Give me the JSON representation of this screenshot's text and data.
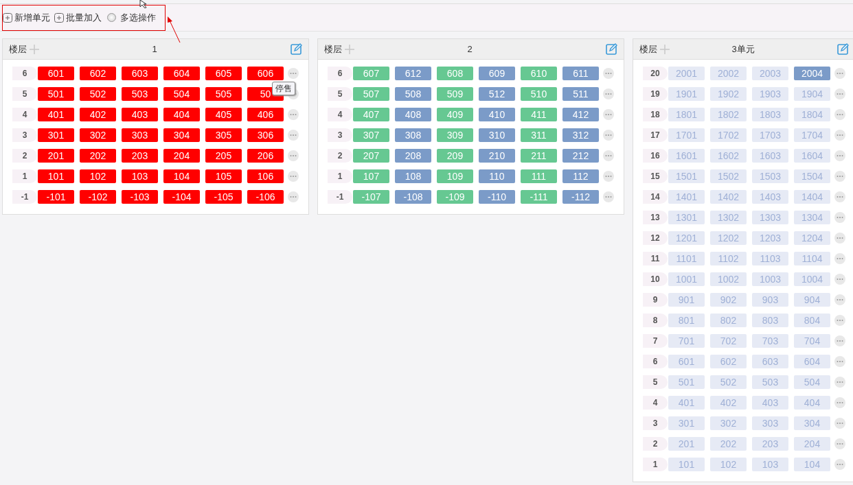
{
  "toolbar": {
    "buttons": [
      {
        "label": "新增单元"
      },
      {
        "label": "批量加入"
      }
    ],
    "multi_select": {
      "label": "多选操作",
      "checked": false
    }
  },
  "panels": [
    {
      "floor_label": "楼层",
      "title": "1",
      "floors": [
        {
          "floor": "6",
          "units": [
            {
              "number": "601",
              "kind": "stopped"
            },
            {
              "number": "602",
              "kind": "stopped"
            },
            {
              "number": "603",
              "kind": "stopped"
            },
            {
              "number": "604",
              "kind": "stopped"
            },
            {
              "number": "605",
              "kind": "stopped"
            },
            {
              "number": "606",
              "kind": "stopped"
            }
          ]
        },
        {
          "floor": "5",
          "units": [
            {
              "number": "501",
              "kind": "stopped"
            },
            {
              "number": "502",
              "kind": "stopped"
            },
            {
              "number": "503",
              "kind": "stopped"
            },
            {
              "number": "504",
              "kind": "stopped"
            },
            {
              "number": "505",
              "kind": "stopped"
            },
            {
              "number": "50",
              "kind": "stopped",
              "tooltip": "停售"
            }
          ]
        },
        {
          "floor": "4",
          "units": [
            {
              "number": "401",
              "kind": "stopped"
            },
            {
              "number": "402",
              "kind": "stopped"
            },
            {
              "number": "403",
              "kind": "stopped"
            },
            {
              "number": "404",
              "kind": "stopped"
            },
            {
              "number": "405",
              "kind": "stopped"
            },
            {
              "number": "406",
              "kind": "stopped"
            }
          ]
        },
        {
          "floor": "3",
          "units": [
            {
              "number": "301",
              "kind": "stopped"
            },
            {
              "number": "302",
              "kind": "stopped"
            },
            {
              "number": "303",
              "kind": "stopped"
            },
            {
              "number": "304",
              "kind": "stopped"
            },
            {
              "number": "305",
              "kind": "stopped"
            },
            {
              "number": "306",
              "kind": "stopped"
            }
          ]
        },
        {
          "floor": "2",
          "units": [
            {
              "number": "201",
              "kind": "stopped"
            },
            {
              "number": "202",
              "kind": "stopped"
            },
            {
              "number": "203",
              "kind": "stopped"
            },
            {
              "number": "204",
              "kind": "stopped"
            },
            {
              "number": "205",
              "kind": "stopped"
            },
            {
              "number": "206",
              "kind": "stopped"
            }
          ]
        },
        {
          "floor": "1",
          "units": [
            {
              "number": "101",
              "kind": "stopped"
            },
            {
              "number": "102",
              "kind": "stopped"
            },
            {
              "number": "103",
              "kind": "stopped"
            },
            {
              "number": "104",
              "kind": "stopped"
            },
            {
              "number": "105",
              "kind": "stopped"
            },
            {
              "number": "106",
              "kind": "stopped"
            }
          ]
        },
        {
          "floor": "-1",
          "units": [
            {
              "number": "-101",
              "kind": "stopped"
            },
            {
              "number": "-102",
              "kind": "stopped"
            },
            {
              "number": "-103",
              "kind": "stopped"
            },
            {
              "number": "-104",
              "kind": "stopped"
            },
            {
              "number": "-105",
              "kind": "stopped"
            },
            {
              "number": "-106",
              "kind": "stopped"
            }
          ]
        }
      ]
    },
    {
      "floor_label": "楼层",
      "title": "2",
      "floors": [
        {
          "floor": "6",
          "units": [
            {
              "number": "607",
              "kind": "green"
            },
            {
              "number": "612",
              "kind": "blue"
            },
            {
              "number": "608",
              "kind": "green"
            },
            {
              "number": "609",
              "kind": "blue"
            },
            {
              "number": "610",
              "kind": "green"
            },
            {
              "number": "611",
              "kind": "blue"
            }
          ]
        },
        {
          "floor": "5",
          "units": [
            {
              "number": "507",
              "kind": "green"
            },
            {
              "number": "508",
              "kind": "blue"
            },
            {
              "number": "509",
              "kind": "green"
            },
            {
              "number": "512",
              "kind": "blue"
            },
            {
              "number": "510",
              "kind": "green"
            },
            {
              "number": "511",
              "kind": "blue"
            }
          ]
        },
        {
          "floor": "4",
          "units": [
            {
              "number": "407",
              "kind": "green"
            },
            {
              "number": "408",
              "kind": "blue"
            },
            {
              "number": "409",
              "kind": "green"
            },
            {
              "number": "410",
              "kind": "blue"
            },
            {
              "number": "411",
              "kind": "green"
            },
            {
              "number": "412",
              "kind": "blue"
            }
          ]
        },
        {
          "floor": "3",
          "units": [
            {
              "number": "307",
              "kind": "green"
            },
            {
              "number": "308",
              "kind": "blue"
            },
            {
              "number": "309",
              "kind": "green"
            },
            {
              "number": "310",
              "kind": "blue"
            },
            {
              "number": "311",
              "kind": "green"
            },
            {
              "number": "312",
              "kind": "blue"
            }
          ]
        },
        {
          "floor": "2",
          "units": [
            {
              "number": "207",
              "kind": "green"
            },
            {
              "number": "208",
              "kind": "blue"
            },
            {
              "number": "209",
              "kind": "green"
            },
            {
              "number": "210",
              "kind": "blue"
            },
            {
              "number": "211",
              "kind": "green"
            },
            {
              "number": "212",
              "kind": "blue"
            }
          ]
        },
        {
          "floor": "1",
          "units": [
            {
              "number": "107",
              "kind": "green"
            },
            {
              "number": "108",
              "kind": "blue"
            },
            {
              "number": "109",
              "kind": "green"
            },
            {
              "number": "110",
              "kind": "blue"
            },
            {
              "number": "111",
              "kind": "green"
            },
            {
              "number": "112",
              "kind": "blue"
            }
          ]
        },
        {
          "floor": "-1",
          "units": [
            {
              "number": "-107",
              "kind": "green"
            },
            {
              "number": "-108",
              "kind": "blue"
            },
            {
              "number": "-109",
              "kind": "green"
            },
            {
              "number": "-110",
              "kind": "blue"
            },
            {
              "number": "-111",
              "kind": "green"
            },
            {
              "number": "-112",
              "kind": "blue"
            }
          ]
        }
      ]
    },
    {
      "floor_label": "楼层",
      "title": "3单元",
      "floors": [
        {
          "floor": "20",
          "units": [
            {
              "number": "2001",
              "kind": "empty"
            },
            {
              "number": "2002",
              "kind": "empty"
            },
            {
              "number": "2003",
              "kind": "empty"
            },
            {
              "number": "2004",
              "kind": "blue"
            }
          ]
        },
        {
          "floor": "19",
          "units": [
            {
              "number": "1901",
              "kind": "empty"
            },
            {
              "number": "1902",
              "kind": "empty"
            },
            {
              "number": "1903",
              "kind": "empty"
            },
            {
              "number": "1904",
              "kind": "empty"
            }
          ]
        },
        {
          "floor": "18",
          "units": [
            {
              "number": "1801",
              "kind": "empty"
            },
            {
              "number": "1802",
              "kind": "empty"
            },
            {
              "number": "1803",
              "kind": "empty"
            },
            {
              "number": "1804",
              "kind": "empty"
            }
          ]
        },
        {
          "floor": "17",
          "units": [
            {
              "number": "1701",
              "kind": "empty"
            },
            {
              "number": "1702",
              "kind": "empty"
            },
            {
              "number": "1703",
              "kind": "empty"
            },
            {
              "number": "1704",
              "kind": "empty"
            }
          ]
        },
        {
          "floor": "16",
          "units": [
            {
              "number": "1601",
              "kind": "empty"
            },
            {
              "number": "1602",
              "kind": "empty"
            },
            {
              "number": "1603",
              "kind": "empty"
            },
            {
              "number": "1604",
              "kind": "empty"
            }
          ]
        },
        {
          "floor": "15",
          "units": [
            {
              "number": "1501",
              "kind": "empty"
            },
            {
              "number": "1502",
              "kind": "empty"
            },
            {
              "number": "1503",
              "kind": "empty"
            },
            {
              "number": "1504",
              "kind": "empty"
            }
          ]
        },
        {
          "floor": "14",
          "units": [
            {
              "number": "1401",
              "kind": "empty"
            },
            {
              "number": "1402",
              "kind": "empty"
            },
            {
              "number": "1403",
              "kind": "empty"
            },
            {
              "number": "1404",
              "kind": "empty"
            }
          ]
        },
        {
          "floor": "13",
          "units": [
            {
              "number": "1301",
              "kind": "empty"
            },
            {
              "number": "1302",
              "kind": "empty"
            },
            {
              "number": "1303",
              "kind": "empty"
            },
            {
              "number": "1304",
              "kind": "empty"
            }
          ]
        },
        {
          "floor": "12",
          "units": [
            {
              "number": "1201",
              "kind": "empty"
            },
            {
              "number": "1202",
              "kind": "empty"
            },
            {
              "number": "1203",
              "kind": "empty"
            },
            {
              "number": "1204",
              "kind": "empty"
            }
          ]
        },
        {
          "floor": "11",
          "units": [
            {
              "number": "1101",
              "kind": "empty"
            },
            {
              "number": "1102",
              "kind": "empty"
            },
            {
              "number": "1103",
              "kind": "empty"
            },
            {
              "number": "1104",
              "kind": "empty"
            }
          ]
        },
        {
          "floor": "10",
          "units": [
            {
              "number": "1001",
              "kind": "empty"
            },
            {
              "number": "1002",
              "kind": "empty"
            },
            {
              "number": "1003",
              "kind": "empty"
            },
            {
              "number": "1004",
              "kind": "empty"
            }
          ]
        },
        {
          "floor": "9",
          "units": [
            {
              "number": "901",
              "kind": "empty"
            },
            {
              "number": "902",
              "kind": "empty"
            },
            {
              "number": "903",
              "kind": "empty"
            },
            {
              "number": "904",
              "kind": "empty"
            }
          ]
        },
        {
          "floor": "8",
          "units": [
            {
              "number": "801",
              "kind": "empty"
            },
            {
              "number": "802",
              "kind": "empty"
            },
            {
              "number": "803",
              "kind": "empty"
            },
            {
              "number": "804",
              "kind": "empty"
            }
          ]
        },
        {
          "floor": "7",
          "units": [
            {
              "number": "701",
              "kind": "empty"
            },
            {
              "number": "702",
              "kind": "empty"
            },
            {
              "number": "703",
              "kind": "empty"
            },
            {
              "number": "704",
              "kind": "empty"
            }
          ]
        },
        {
          "floor": "6",
          "units": [
            {
              "number": "601",
              "kind": "empty"
            },
            {
              "number": "602",
              "kind": "empty"
            },
            {
              "number": "603",
              "kind": "empty"
            },
            {
              "number": "604",
              "kind": "empty"
            }
          ]
        },
        {
          "floor": "5",
          "units": [
            {
              "number": "501",
              "kind": "empty"
            },
            {
              "number": "502",
              "kind": "empty"
            },
            {
              "number": "503",
              "kind": "empty"
            },
            {
              "number": "504",
              "kind": "empty"
            }
          ]
        },
        {
          "floor": "4",
          "units": [
            {
              "number": "401",
              "kind": "empty"
            },
            {
              "number": "402",
              "kind": "empty"
            },
            {
              "number": "403",
              "kind": "empty"
            },
            {
              "number": "404",
              "kind": "empty"
            }
          ]
        },
        {
          "floor": "3",
          "units": [
            {
              "number": "301",
              "kind": "empty"
            },
            {
              "number": "302",
              "kind": "empty"
            },
            {
              "number": "303",
              "kind": "empty"
            },
            {
              "number": "304",
              "kind": "empty"
            }
          ]
        },
        {
          "floor": "2",
          "units": [
            {
              "number": "201",
              "kind": "empty"
            },
            {
              "number": "202",
              "kind": "empty"
            },
            {
              "number": "203",
              "kind": "empty"
            },
            {
              "number": "204",
              "kind": "empty"
            }
          ]
        },
        {
          "floor": "1",
          "units": [
            {
              "number": "101",
              "kind": "empty"
            },
            {
              "number": "102",
              "kind": "empty"
            },
            {
              "number": "103",
              "kind": "empty"
            },
            {
              "number": "104",
              "kind": "empty"
            }
          ]
        }
      ]
    }
  ]
}
